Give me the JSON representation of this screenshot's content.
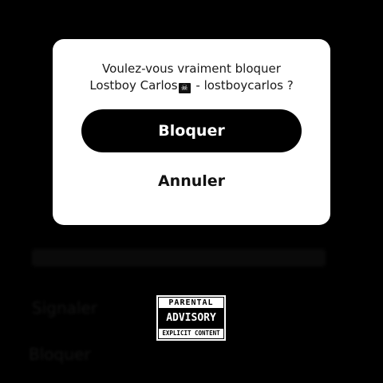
{
  "dialog": {
    "message_line1": "Voulez-vous vraiment bloquer",
    "message_name": "Lostboy Carlos",
    "message_icon": "pirate-flag-icon",
    "message_rest": " - lostboycarlos ?",
    "confirm_label": "Bloquer",
    "cancel_label": "Annuler"
  },
  "background": {
    "text_one": "Signaler",
    "text_two": "Bloquer"
  },
  "advisory_label": {
    "top": "PARENTAL",
    "middle": "ADVISORY",
    "bottom": "EXPLICIT CONTENT"
  },
  "colors": {
    "overlay": "#000000",
    "dialog_background": "#ffffff",
    "primary_button": "#000000",
    "primary_button_text": "#ffffff"
  }
}
